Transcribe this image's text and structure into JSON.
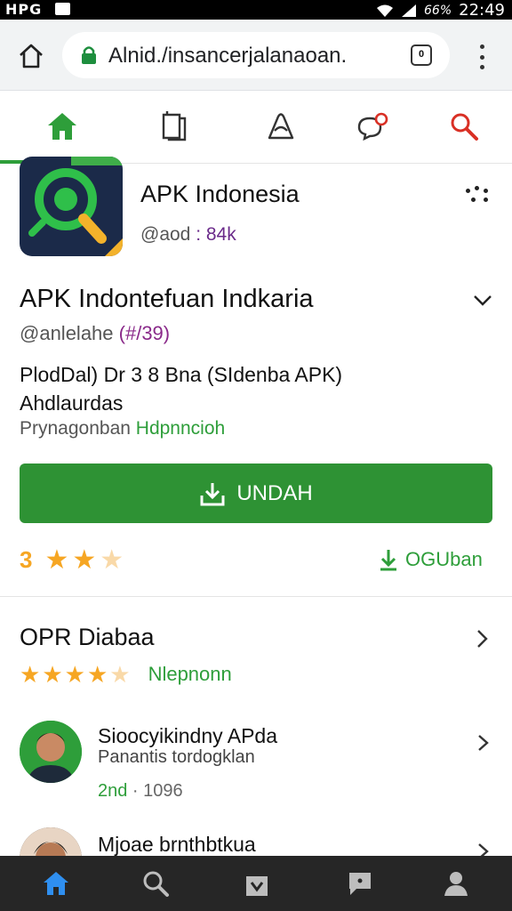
{
  "status_bar": {
    "left_label": "HPG",
    "battery": "66%",
    "time": "22:49"
  },
  "url_bar": {
    "url": "Alnid./insancerjalanaoan.",
    "tab_count": "0"
  },
  "app_nav": {
    "items": [
      {
        "label": "home-icon",
        "active": true
      },
      {
        "label": "book-icon",
        "active": false
      },
      {
        "label": "apps-icon",
        "active": false
      },
      {
        "label": "notification-icon",
        "active": false
      },
      {
        "label": "search-icon",
        "active": false
      }
    ],
    "accent_color": "#2e9e3a"
  },
  "app": {
    "name": "APK Indonesia",
    "handle": "@aod",
    "handle_count": " : 84k",
    "title": "APK Indontefuan Indkaria",
    "developer": "@anlelahe ",
    "developer_tag": "(#/39)",
    "desc_line1": "PlodDal) Dr 3 8 Bna  (SIdenba APK)",
    "desc_line2": "Ahdlaurdas",
    "category_prefix": "Prynagonban ",
    "category": "Hdpnncioh",
    "install_label": "UNDAH",
    "rating_value": "3",
    "download_label": "OGUban"
  },
  "reviews": {
    "title": "OPR Diabaa",
    "rating_value": 4.5,
    "count_label": "Nlepnonn",
    "items": [
      {
        "name": "Sioocyikindny APda",
        "text": "Panantis tordogklan",
        "date": "2nd",
        "count": " · 1096"
      },
      {
        "name": "Mjoae brnthbtkua",
        "text": "",
        "date": "",
        "count": ""
      }
    ]
  },
  "bottom_nav": {
    "items": [
      "home-icon",
      "search-icon",
      "bag-icon",
      "chat-icon",
      "profile-icon"
    ],
    "active_color": "#2f8ff0"
  }
}
